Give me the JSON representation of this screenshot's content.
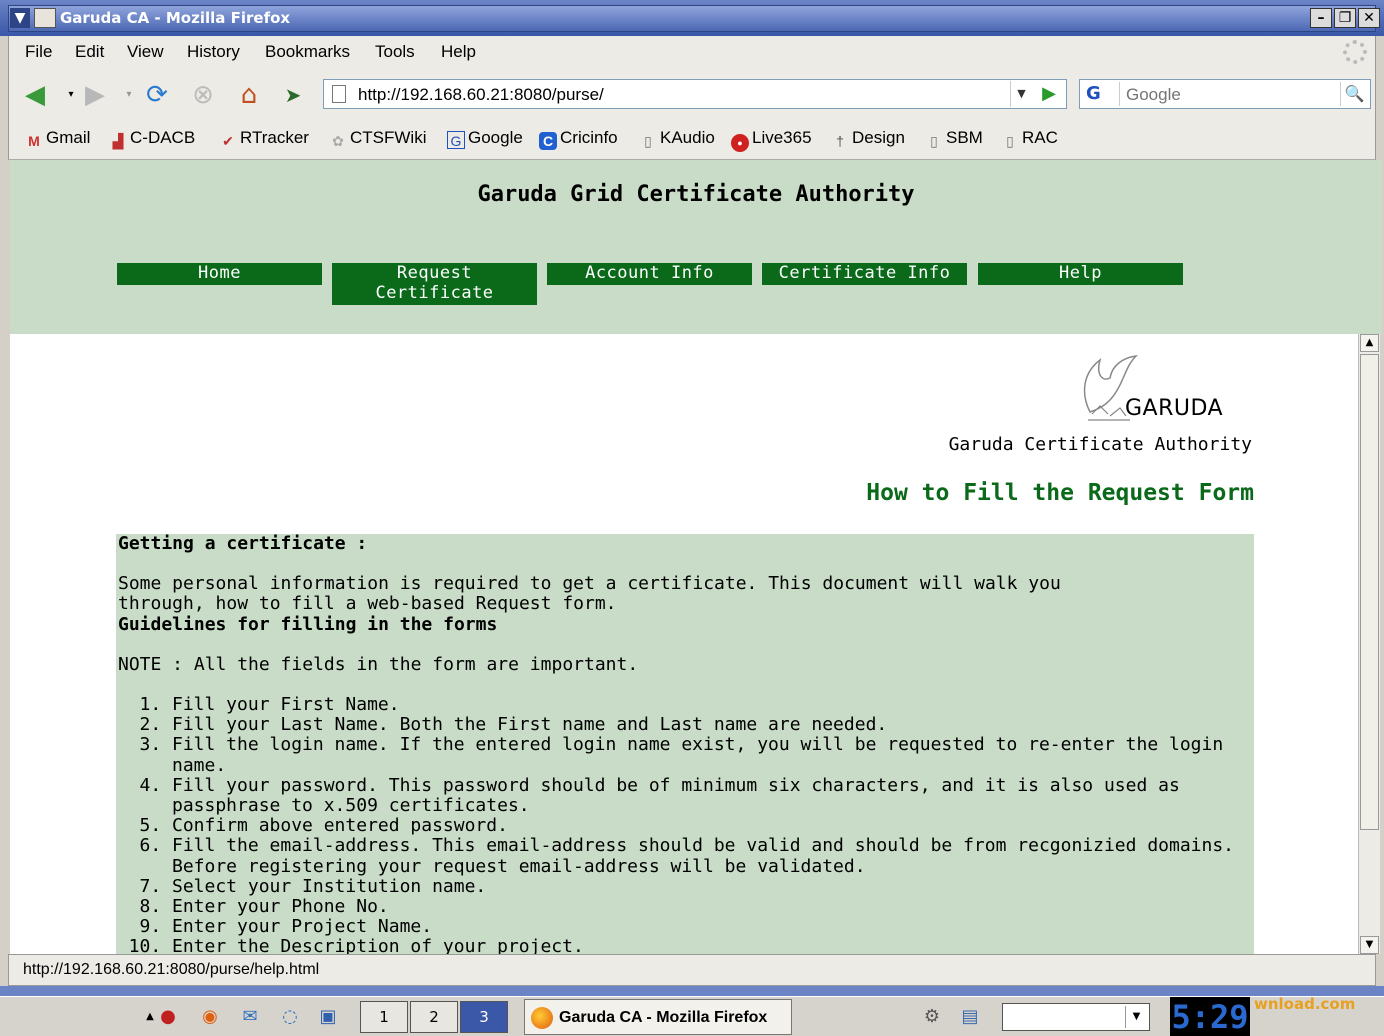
{
  "window": {
    "title": "Garuda CA - Mozilla Firefox"
  },
  "menubar": {
    "items": [
      "File",
      "Edit",
      "View",
      "History",
      "Bookmarks",
      "Tools",
      "Help"
    ]
  },
  "navbar": {
    "url": "http://192.168.60.21:8080/purse/",
    "search_placeholder": "Google",
    "search_engine": "G"
  },
  "bookmarks": [
    {
      "label": "Gmail",
      "icon": "gmail-icon"
    },
    {
      "label": "C-DACB",
      "icon": "chart-icon"
    },
    {
      "label": "RTracker",
      "icon": "check-icon"
    },
    {
      "label": "CTSFWiki",
      "icon": "wiki-icon"
    },
    {
      "label": "Google",
      "icon": "google-icon"
    },
    {
      "label": "Cricinfo",
      "icon": "cricinfo-icon"
    },
    {
      "label": "KAudio",
      "icon": "page-icon"
    },
    {
      "label": "Live365",
      "icon": "live365-icon"
    },
    {
      "label": "Design",
      "icon": "design-icon"
    },
    {
      "label": "SBM",
      "icon": "page-icon"
    },
    {
      "label": "RAC",
      "icon": "page-icon"
    }
  ],
  "page": {
    "title": "Garuda Grid Certificate Authority",
    "nav": {
      "home": "Home",
      "request_line1": "Request",
      "request_line2": "Certificate",
      "account": "Account Info",
      "certificate": "Certificate Info",
      "help": "Help"
    },
    "logo_text": "GARUDA",
    "ca_subtitle": "Garuda Certificate Authority",
    "section_title": "How to Fill the Request Form",
    "guide": {
      "heading": "Getting a certificate :",
      "intro_line1": "Some personal information is required to get a certificate. This document will walk you",
      "intro_line2": "through, how to fill a web-based Request form.",
      "guidelines": "Guidelines for filling in the forms",
      "note": "NOTE : All the fields in the form are important.",
      "steps": [
        "Fill your First Name.",
        "Fill your Last Name. Both the First name and Last name are needed.",
        "Fill the login name. If the entered login name exist, you will be requested to re-enter the login name.",
        "Fill your password. This password should be of minimum six characters, and it is also used as passphrase to x.509 certificates.",
        "Confirm above entered password.",
        "Fill the email-address. This email-address should be valid and should be from recgonizied domains. Before registering your request email-address will be validated.",
        "Select your Institution name.",
        "Enter your Phone No.",
        "Enter your Project Name.",
        "Enter the Description of your project."
      ]
    }
  },
  "statusbar": {
    "text": "http://192.168.60.21:8080/purse/help.html"
  },
  "taskbar": {
    "workspaces": [
      "1",
      "2",
      "3"
    ],
    "task_label": "Garuda CA - Mozilla Firefox",
    "clock": "5:29",
    "watermark": "wnload.com"
  },
  "colors": {
    "header_bg": "#c8dcc8",
    "nav_button_bg": "#0a6a1a",
    "section_title": "#0a6a1a"
  }
}
